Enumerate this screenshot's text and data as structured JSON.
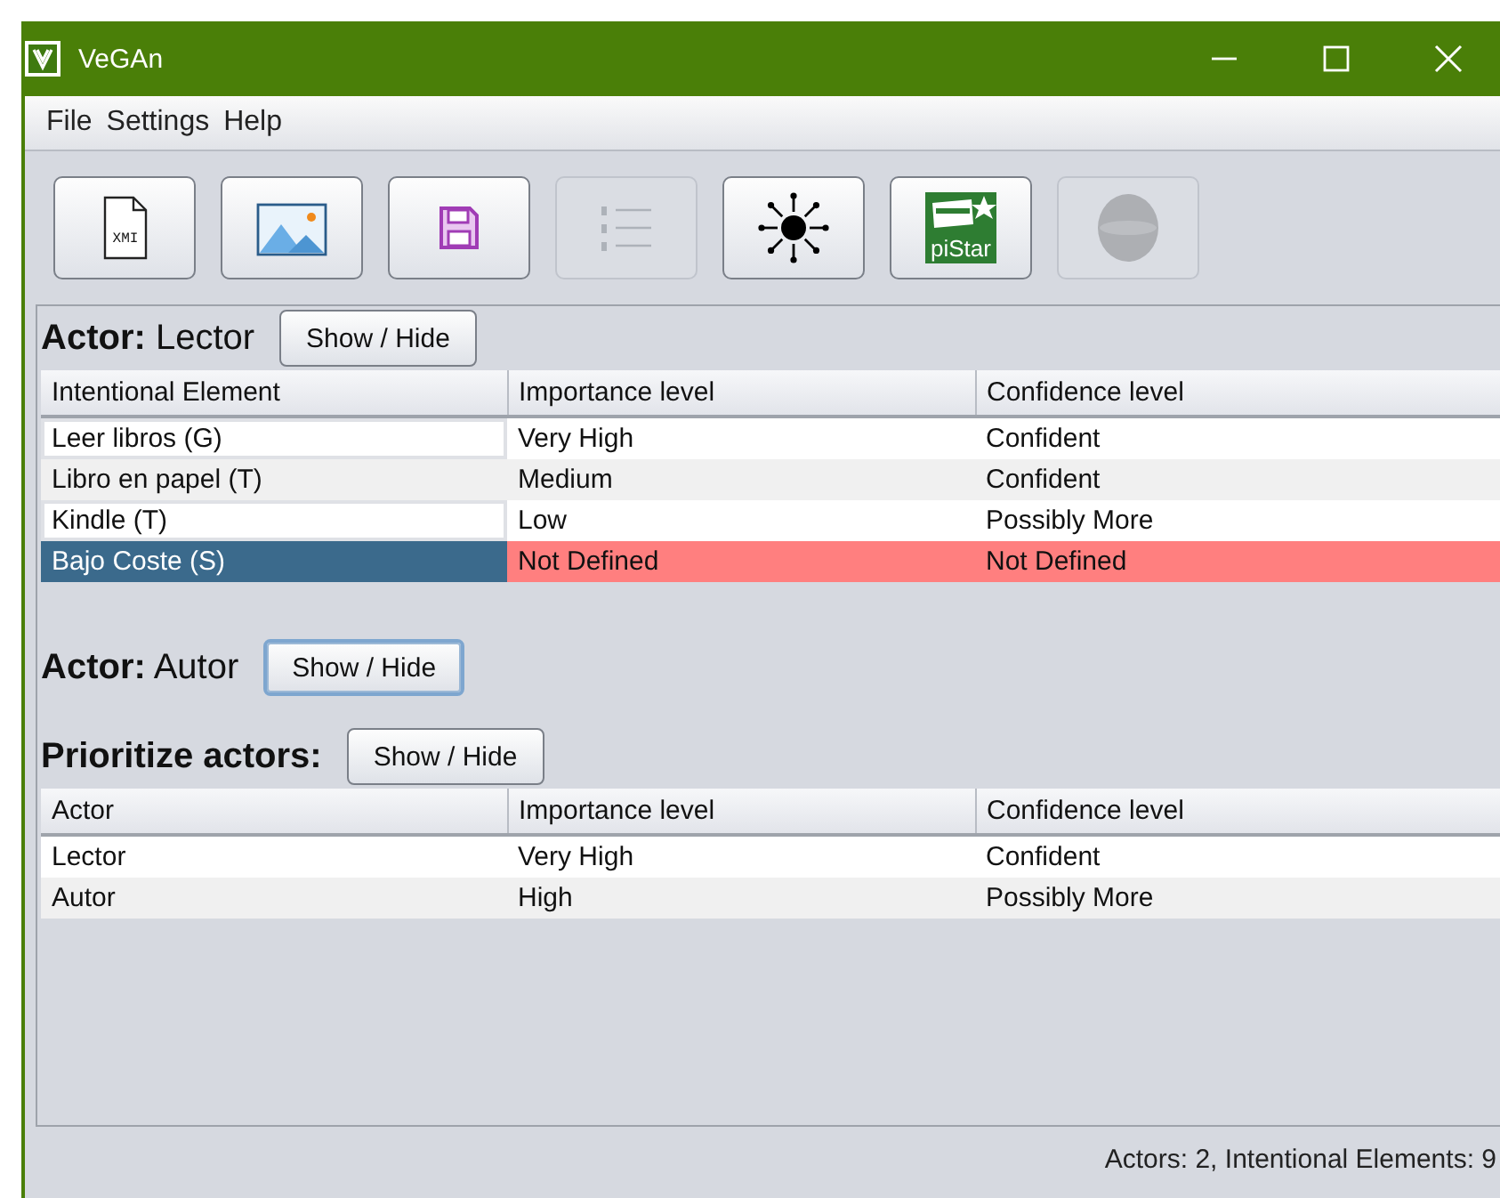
{
  "window": {
    "title": "VeGAn"
  },
  "menu": [
    "File",
    "Settings",
    "Help"
  ],
  "toolbar": [
    {
      "kind": "xmi",
      "label": "XMI",
      "disabled": false
    },
    {
      "kind": "image",
      "disabled": false
    },
    {
      "kind": "save",
      "disabled": false
    },
    {
      "kind": "list",
      "disabled": true
    },
    {
      "kind": "network",
      "disabled": false
    },
    {
      "kind": "pistar",
      "label": "piStar",
      "disabled": false
    },
    {
      "kind": "egg",
      "disabled": true
    }
  ],
  "sections": [
    {
      "kind": "actor",
      "heading": "Actor:",
      "name": "Lector",
      "button": {
        "label": "Show / Hide",
        "focused": false
      },
      "table": {
        "columns": [
          "Intentional Element",
          "Importance level",
          "Confidence level"
        ],
        "rows": [
          {
            "cells": [
              "Leer libros (G)",
              "Very High",
              "Confident"
            ],
            "selected": false,
            "undefined": false
          },
          {
            "cells": [
              "Libro en papel (T)",
              "Medium",
              "Confident"
            ],
            "selected": false,
            "undefined": false
          },
          {
            "cells": [
              "Kindle (T)",
              "Low",
              "Possibly More"
            ],
            "selected": false,
            "undefined": false
          },
          {
            "cells": [
              "Bajo Coste (S)",
              "Not Defined",
              "Not Defined"
            ],
            "selected": true,
            "undefined": true
          }
        ]
      }
    },
    {
      "kind": "actor",
      "heading": "Actor:",
      "name": "Autor",
      "button": {
        "label": "Show / Hide",
        "focused": true
      }
    },
    {
      "kind": "priority",
      "heading": "Prioritize actors:",
      "button": {
        "label": "Show / Hide",
        "focused": false
      },
      "table": {
        "columns": [
          "Actor",
          "Importance level",
          "Confidence level"
        ],
        "rows": [
          {
            "cells": [
              "Lector",
              "Very High",
              "Confident"
            ],
            "selected": false,
            "undefined": false
          },
          {
            "cells": [
              "Autor",
              "High",
              "Possibly More"
            ],
            "selected": false,
            "undefined": false
          }
        ]
      }
    }
  ],
  "status_bar": "Actors: 2, Intentional Elements: 9"
}
